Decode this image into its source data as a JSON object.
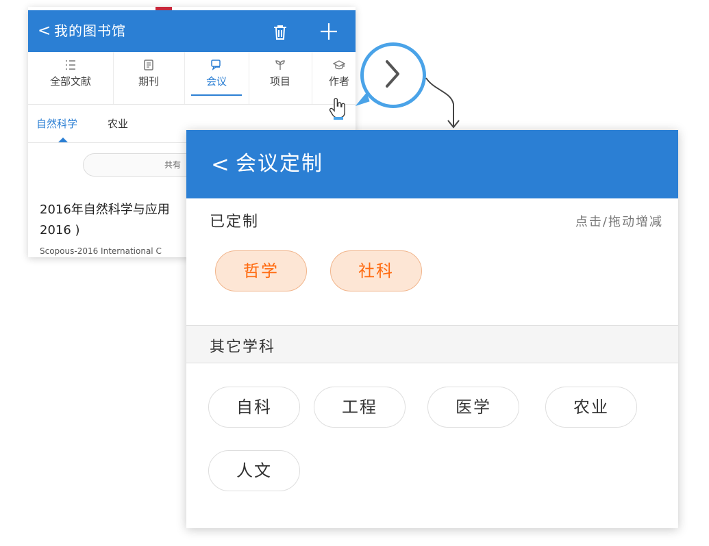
{
  "back_screen": {
    "header": {
      "back_glyph": "<",
      "title": "我的图书馆"
    },
    "tabs": [
      {
        "label": "全部文献",
        "icon": "list-icon"
      },
      {
        "label": "期刊",
        "icon": "journal-icon"
      },
      {
        "label": "会议",
        "icon": "chat-icon",
        "active": true
      },
      {
        "label": "项目",
        "icon": "sprout-icon"
      },
      {
        "label": "作者",
        "icon": "graduation-cap-icon"
      }
    ],
    "subtabs": [
      "自然科学",
      "农业"
    ],
    "count_pill": "共有",
    "article": {
      "line1": "2016年自然科学与应用",
      "line2": "2016 )",
      "source": "Scopous-2016 International C"
    }
  },
  "front_screen": {
    "header": {
      "back_glyph": "<",
      "title": "会议定制"
    },
    "selected_section": {
      "title": "已定制",
      "hint": "点击/拖动增减"
    },
    "selected_chips": [
      "哲学",
      "社科"
    ],
    "other_section": {
      "title": "其它学科"
    },
    "other_chips": [
      "自科",
      "工程",
      "医学",
      "农业",
      "人文"
    ]
  },
  "colors": {
    "header_blue": "#2b7fd4",
    "bubble_blue": "#4aa3e8",
    "chip_selected_bg": "#fde6d5",
    "chip_selected_text": "#ff6a0f"
  }
}
